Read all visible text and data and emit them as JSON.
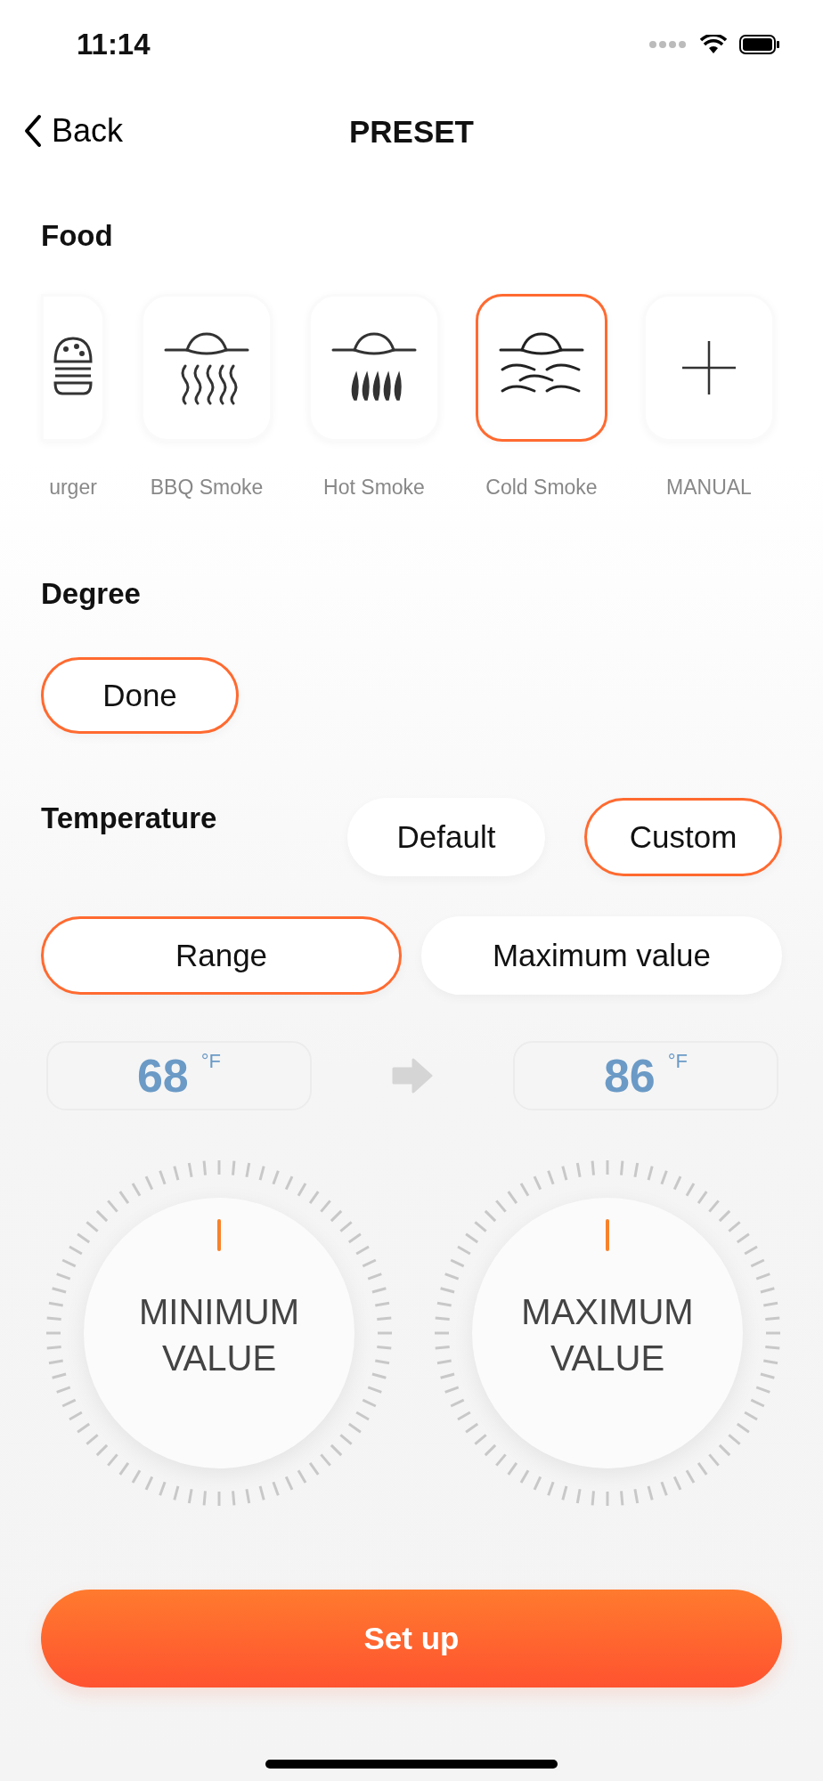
{
  "status_bar": {
    "time": "11:14"
  },
  "nav": {
    "back": "Back",
    "title": "PRESET"
  },
  "food": {
    "heading": "Food",
    "items": [
      {
        "label": "urger",
        "kind": "burger",
        "selected": false
      },
      {
        "label": "BBQ Smoke",
        "kind": "bbq",
        "selected": false
      },
      {
        "label": "Hot Smoke",
        "kind": "hot",
        "selected": false
      },
      {
        "label": "Cold Smoke",
        "kind": "cold",
        "selected": true
      },
      {
        "label": "MANUAL",
        "kind": "plus",
        "selected": false
      }
    ]
  },
  "degree": {
    "heading": "Degree",
    "options": [
      {
        "label": "Done",
        "selected": true
      }
    ]
  },
  "temperature": {
    "heading": "Temperature",
    "modes": [
      {
        "label": "Default",
        "selected": false
      },
      {
        "label": "Custom",
        "selected": true
      }
    ],
    "types": [
      {
        "label": "Range",
        "selected": true
      },
      {
        "label": "Maximum value",
        "selected": false
      }
    ],
    "min": {
      "value": "68",
      "unit": "°F"
    },
    "max": {
      "value": "86",
      "unit": "°F"
    },
    "dials": [
      {
        "label": "MINIMUM VALUE"
      },
      {
        "label": "MAXIMUM VALUE"
      }
    ]
  },
  "action": {
    "label": "Set up"
  }
}
